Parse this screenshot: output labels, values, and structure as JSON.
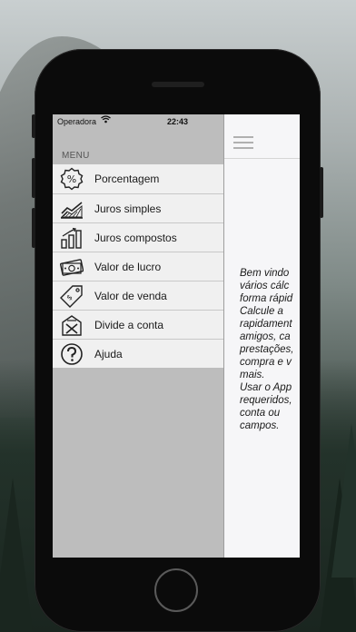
{
  "status_bar": {
    "carrier": "Operadora",
    "time": "22:43",
    "battery_level": 0.85,
    "battery_color": "#3cc45a"
  },
  "menu": {
    "header": "MENU",
    "items": [
      {
        "label": "Porcentagem",
        "icon": "percent-icon"
      },
      {
        "label": "Juros simples",
        "icon": "line-chart-icon"
      },
      {
        "label": "Juros compostos",
        "icon": "bar-chart-icon"
      },
      {
        "label": "Valor de lucro",
        "icon": "money-icon"
      },
      {
        "label": "Valor de venda",
        "icon": "price-tag-icon"
      },
      {
        "label": "Divide a conta",
        "icon": "split-bill-icon"
      },
      {
        "label": "Ajuda",
        "icon": "help-icon"
      }
    ]
  },
  "main": {
    "welcome_lines": [
      "Bem vindo",
      "vários cálc",
      "forma rápid",
      "Calcule a",
      "rapidament",
      "amigos, ca",
      "prestações,",
      "compra e v",
      "mais.",
      "Usar o App",
      "requeridos,",
      "conta ou",
      "campos."
    ]
  }
}
